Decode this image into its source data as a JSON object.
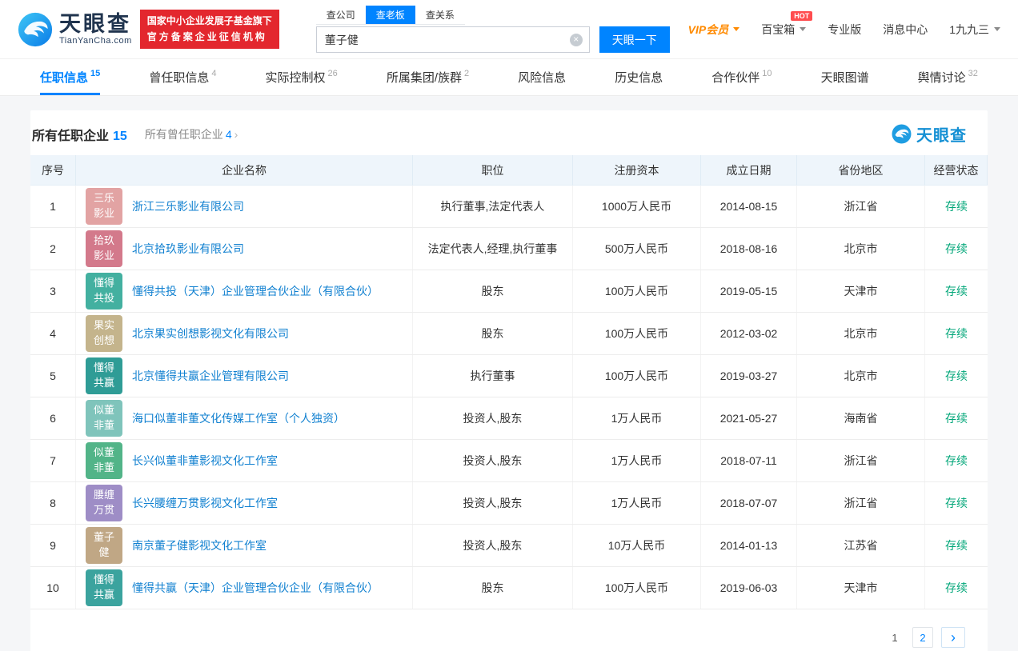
{
  "colors": {
    "accent_blue": "#0084ff",
    "link_blue": "#1080d0",
    "status_green": "#00a678",
    "badge_red": "#e3272e",
    "vip_orange": "#ff8a00",
    "table_header_bg": "#eef5fb"
  },
  "header": {
    "brand": {
      "name": "天眼查",
      "domain": "TianYanCha.com"
    },
    "badge": {
      "line1": "国家中小企业发展子基金旗下",
      "line2": "官方备案企业征信机构"
    },
    "search": {
      "tabs": [
        {
          "label": "查公司",
          "active": false
        },
        {
          "label": "查老板",
          "active": true
        },
        {
          "label": "查关系",
          "active": false
        }
      ],
      "value": "董子健",
      "clear_icon": "×",
      "button": "天眼一下"
    },
    "nav": [
      {
        "label": "VIP会员",
        "style": "vip",
        "caret": true
      },
      {
        "label": "百宝箱",
        "hot": "HOT",
        "caret": true
      },
      {
        "label": "专业版"
      },
      {
        "label": "消息中心"
      },
      {
        "label": "1九九三",
        "caret": true
      }
    ]
  },
  "tabs": [
    {
      "label": "任职信息",
      "count": "15",
      "active": true
    },
    {
      "label": "曾任职信息",
      "count": "4",
      "active": false
    },
    {
      "label": "实际控制权",
      "count": "26",
      "active": false
    },
    {
      "label": "所属集团/族群",
      "count": "2",
      "active": false
    },
    {
      "label": "风险信息",
      "count": "",
      "active": false
    },
    {
      "label": "历史信息",
      "count": "",
      "active": false
    },
    {
      "label": "合作伙伴",
      "count": "10",
      "active": false
    },
    {
      "label": "天眼图谱",
      "count": "",
      "active": false
    },
    {
      "label": "舆情讨论",
      "count": "32",
      "active": false
    }
  ],
  "card": {
    "title": "所有任职企业",
    "title_count": "15",
    "sub_label": "所有曾任职企业",
    "sub_count": "4",
    "sub_arrow": "›",
    "watermark": "天眼查"
  },
  "table": {
    "headers": [
      "序号",
      "企业名称",
      "职位",
      "注册资本",
      "成立日期",
      "省份地区",
      "经营状态"
    ],
    "rows": [
      {
        "no": "1",
        "icon": {
          "text": "三乐\n影业",
          "color": "#e2a3a3"
        },
        "name": "浙江三乐影业有限公司",
        "position": "执行董事,法定代表人",
        "capital": "1000万人民币",
        "date": "2014-08-15",
        "region": "浙江省",
        "status": "存续"
      },
      {
        "no": "2",
        "icon": {
          "text": "拾玖\n影业",
          "color": "#d3798b"
        },
        "name": "北京拾玖影业有限公司",
        "position": "法定代表人,经理,执行董事",
        "capital": "500万人民币",
        "date": "2018-08-16",
        "region": "北京市",
        "status": "存续"
      },
      {
        "no": "3",
        "icon": {
          "text": "懂得\n共投",
          "color": "#43b0a0"
        },
        "name": "懂得共投（天津）企业管理合伙企业（有限合伙）",
        "position": "股东",
        "capital": "100万人民币",
        "date": "2019-05-15",
        "region": "天津市",
        "status": "存续"
      },
      {
        "no": "4",
        "icon": {
          "text": "果实\n创想",
          "color": "#c4b48c"
        },
        "name": "北京果实创想影视文化有限公司",
        "position": "股东",
        "capital": "100万人民币",
        "date": "2012-03-02",
        "region": "北京市",
        "status": "存续"
      },
      {
        "no": "5",
        "icon": {
          "text": "懂得\n共赢",
          "color": "#2f9c96"
        },
        "name": "北京懂得共赢企业管理有限公司",
        "position": "执行董事",
        "capital": "100万人民币",
        "date": "2019-03-27",
        "region": "北京市",
        "status": "存续"
      },
      {
        "no": "6",
        "icon": {
          "text": "似董\n非董",
          "color": "#7fc4bb"
        },
        "name": "海口似董非董文化传媒工作室（个人独资）",
        "position": "投资人,股东",
        "capital": "1万人民币",
        "date": "2021-05-27",
        "region": "海南省",
        "status": "存续"
      },
      {
        "no": "7",
        "icon": {
          "text": "似董\n非董",
          "color": "#52b488"
        },
        "name": "长兴似董非董影视文化工作室",
        "position": "投资人,股东",
        "capital": "1万人民币",
        "date": "2018-07-11",
        "region": "浙江省",
        "status": "存续"
      },
      {
        "no": "8",
        "icon": {
          "text": "腰缠\n万贯",
          "color": "#9e8dc6"
        },
        "name": "长兴腰缠万贯影视文化工作室",
        "position": "投资人,股东",
        "capital": "1万人民币",
        "date": "2018-07-07",
        "region": "浙江省",
        "status": "存续"
      },
      {
        "no": "9",
        "icon": {
          "text": "董子\n健",
          "color": "#c0a785"
        },
        "name": "南京董子健影视文化工作室",
        "position": "投资人,股东",
        "capital": "10万人民币",
        "date": "2014-01-13",
        "region": "江苏省",
        "status": "存续"
      },
      {
        "no": "10",
        "icon": {
          "text": "懂得\n共赢",
          "color": "#3ba39e"
        },
        "name": "懂得共赢（天津）企业管理合伙企业（有限合伙）",
        "position": "股东",
        "capital": "100万人民币",
        "date": "2019-06-03",
        "region": "天津市",
        "status": "存续"
      }
    ]
  },
  "pagination": {
    "current": "1",
    "page2": "2",
    "next": "›"
  }
}
